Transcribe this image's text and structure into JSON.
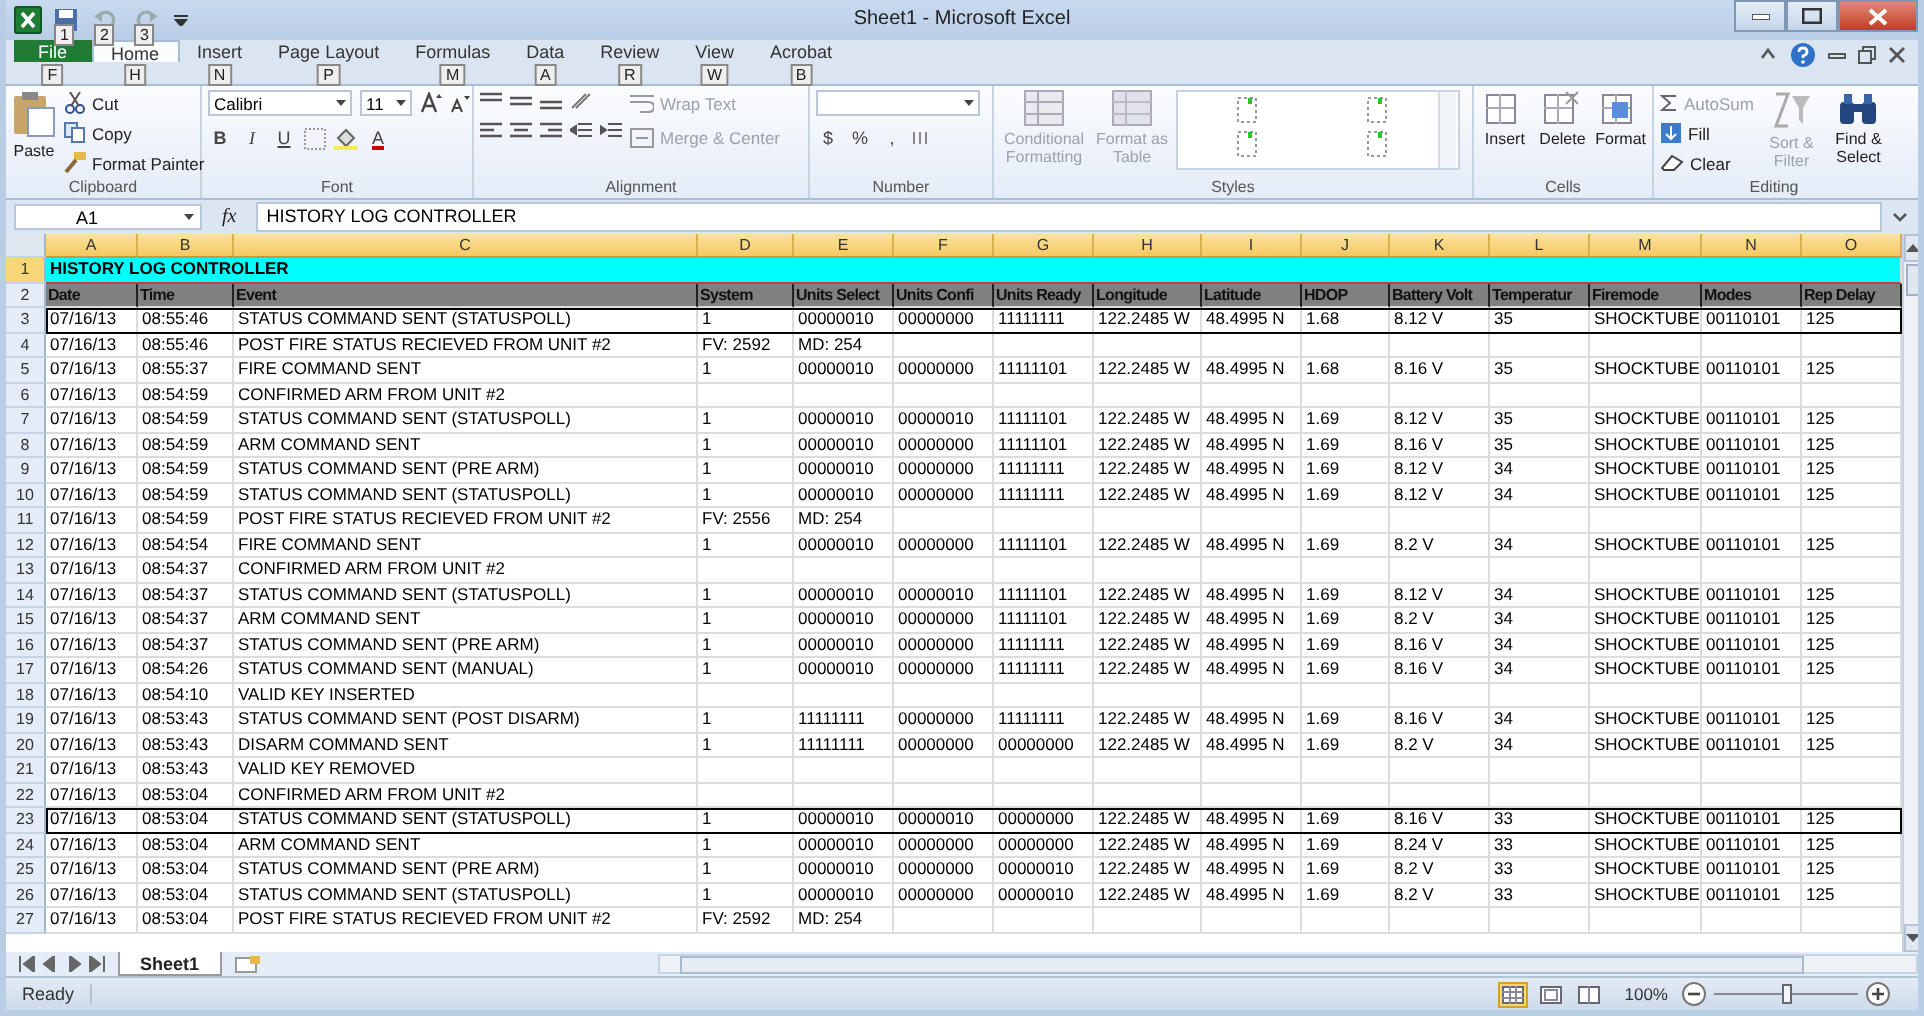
{
  "window": {
    "title": "Sheet1  -  Microsoft Excel"
  },
  "quick_access": [
    {
      "keytip": "1"
    },
    {
      "keytip": "2"
    },
    {
      "keytip": "3"
    }
  ],
  "tabs": [
    {
      "label": "File",
      "keytip": "F",
      "selected": false,
      "kind": "file"
    },
    {
      "label": "Home",
      "keytip": "H",
      "selected": true,
      "kind": "tab"
    },
    {
      "label": "Insert",
      "keytip": "N",
      "selected": false,
      "kind": "tab"
    },
    {
      "label": "Page Layout",
      "keytip": "P",
      "selected": false,
      "kind": "tab"
    },
    {
      "label": "Formulas",
      "keytip": "M",
      "selected": false,
      "kind": "tab"
    },
    {
      "label": "Data",
      "keytip": "A",
      "selected": false,
      "kind": "tab"
    },
    {
      "label": "Review",
      "keytip": "R",
      "selected": false,
      "kind": "tab"
    },
    {
      "label": "View",
      "keytip": "W",
      "selected": false,
      "kind": "tab"
    },
    {
      "label": "Acrobat",
      "keytip": "B",
      "selected": false,
      "kind": "tab"
    }
  ],
  "ribbon": {
    "clipboard": {
      "label": "Clipboard",
      "paste": "Paste",
      "cut": "Cut",
      "copy": "Copy",
      "format_painter": "Format Painter"
    },
    "font": {
      "label": "Font",
      "name": "Calibri",
      "size": "11",
      "bold": "B",
      "italic": "I",
      "underline": "U",
      "text_color": "A"
    },
    "alignment": {
      "label": "Alignment",
      "wrap": {
        "label": "Wrap Text",
        "disabled": true
      },
      "merge": {
        "label": "Merge & Center",
        "disabled": true
      }
    },
    "number": {
      "label": "Number",
      "currency": "$",
      "percent": "%",
      "comma": ","
    },
    "styles": {
      "label": "Styles",
      "conditional": {
        "label": "Conditional Formatting",
        "disabled": true
      },
      "table": {
        "label": "Format as Table",
        "disabled": true
      }
    },
    "cells": {
      "label": "Cells",
      "buttons": [
        {
          "label": "Insert",
          "disabled": false
        },
        {
          "label": "Delete",
          "disabled": false
        },
        {
          "label": "Format",
          "disabled": false
        }
      ]
    },
    "editing": {
      "label": "Editing",
      "autosum": {
        "label": "AutoSum",
        "disabled": true
      },
      "fill": {
        "label": "Fill",
        "disabled": false
      },
      "clear": {
        "label": "Clear",
        "disabled": false
      },
      "sort": {
        "label": "Sort & Filter",
        "disabled": true
      },
      "find": {
        "label": "Find & Select",
        "disabled": false
      }
    }
  },
  "formula_bar": {
    "name_box": "A1",
    "fx": "fx",
    "value": "HISTORY LOG CONTROLLER"
  },
  "columns": [
    "A",
    "B",
    "C",
    "D",
    "E",
    "F",
    "G",
    "H",
    "I",
    "J",
    "K",
    "L",
    "M",
    "N",
    "O"
  ],
  "title_row": {
    "n": "1",
    "text": "HISTORY LOG CONTROLLER"
  },
  "header_row": {
    "n": "2",
    "cells": [
      "Date",
      "Time",
      "Event",
      "System",
      "Units Select",
      "Units Confi",
      "Units Ready",
      "Longitude",
      "Latitude",
      "HDOP",
      "Battery Volt",
      "Temperatur",
      "Firemode",
      "Modes",
      "Rep Delay"
    ]
  },
  "rows": [
    {
      "n": "3",
      "boxed": true,
      "cells": [
        "07/16/13",
        "08:55:46",
        "STATUS COMMAND SENT (STATUSPOLL)",
        "1",
        "00000010",
        "00000000",
        "11111111",
        "122.2485 W",
        "48.4995 N",
        "1.68",
        "8.12 V",
        "35",
        "SHOCKTUBE",
        "00110101",
        "125"
      ]
    },
    {
      "n": "4",
      "boxed": false,
      "cells": [
        "07/16/13",
        "08:55:46",
        "POST FIRE STATUS RECIEVED FROM UNIT #2",
        "FV: 2592",
        "MD: 254"
      ]
    },
    {
      "n": "5",
      "boxed": false,
      "cells": [
        "07/16/13",
        "08:55:37",
        "FIRE COMMAND SENT",
        "1",
        "00000010",
        "00000000",
        "11111101",
        "122.2485 W",
        "48.4995 N",
        "1.68",
        "8.16 V",
        "35",
        "SHOCKTUBE",
        "00110101",
        "125"
      ]
    },
    {
      "n": "6",
      "boxed": false,
      "cells": [
        "07/16/13",
        "08:54:59",
        "CONFIRMED ARM FROM UNIT #2"
      ]
    },
    {
      "n": "7",
      "boxed": false,
      "cells": [
        "07/16/13",
        "08:54:59",
        "STATUS COMMAND SENT (STATUSPOLL)",
        "1",
        "00000010",
        "00000010",
        "11111101",
        "122.2485 W",
        "48.4995 N",
        "1.69",
        "8.12 V",
        "35",
        "SHOCKTUBE",
        "00110101",
        "125"
      ]
    },
    {
      "n": "8",
      "boxed": false,
      "cells": [
        "07/16/13",
        "08:54:59",
        "ARM COMMAND SENT",
        "1",
        "00000010",
        "00000000",
        "11111101",
        "122.2485 W",
        "48.4995 N",
        "1.69",
        "8.16 V",
        "35",
        "SHOCKTUBE",
        "00110101",
        "125"
      ]
    },
    {
      "n": "9",
      "boxed": false,
      "cells": [
        "07/16/13",
        "08:54:59",
        "STATUS COMMAND SENT (PRE ARM)",
        "1",
        "00000010",
        "00000000",
        "11111111",
        "122.2485 W",
        "48.4995 N",
        "1.69",
        "8.12 V",
        "34",
        "SHOCKTUBE",
        "00110101",
        "125"
      ]
    },
    {
      "n": "10",
      "boxed": false,
      "cells": [
        "07/16/13",
        "08:54:59",
        "STATUS COMMAND SENT (STATUSPOLL)",
        "1",
        "00000010",
        "00000000",
        "11111111",
        "122.2485 W",
        "48.4995 N",
        "1.69",
        "8.12 V",
        "34",
        "SHOCKTUBE",
        "00110101",
        "125"
      ]
    },
    {
      "n": "11",
      "boxed": false,
      "cells": [
        "07/16/13",
        "08:54:59",
        "POST FIRE STATUS RECIEVED FROM UNIT #2",
        "FV: 2556",
        "MD: 254"
      ]
    },
    {
      "n": "12",
      "boxed": false,
      "cells": [
        "07/16/13",
        "08:54:54",
        "FIRE COMMAND SENT",
        "1",
        "00000010",
        "00000000",
        "11111101",
        "122.2485 W",
        "48.4995 N",
        "1.69",
        "8.2 V",
        "34",
        "SHOCKTUBE",
        "00110101",
        "125"
      ]
    },
    {
      "n": "13",
      "boxed": false,
      "cells": [
        "07/16/13",
        "08:54:37",
        "CONFIRMED ARM FROM UNIT #2"
      ]
    },
    {
      "n": "14",
      "boxed": false,
      "cells": [
        "07/16/13",
        "08:54:37",
        "STATUS COMMAND SENT (STATUSPOLL)",
        "1",
        "00000010",
        "00000010",
        "11111101",
        "122.2485 W",
        "48.4995 N",
        "1.69",
        "8.12 V",
        "34",
        "SHOCKTUBE",
        "00110101",
        "125"
      ]
    },
    {
      "n": "15",
      "boxed": false,
      "cells": [
        "07/16/13",
        "08:54:37",
        "ARM COMMAND SENT",
        "1",
        "00000010",
        "00000000",
        "11111101",
        "122.2485 W",
        "48.4995 N",
        "1.69",
        "8.2 V",
        "34",
        "SHOCKTUBE",
        "00110101",
        "125"
      ]
    },
    {
      "n": "16",
      "boxed": false,
      "cells": [
        "07/16/13",
        "08:54:37",
        "STATUS COMMAND SENT (PRE ARM)",
        "1",
        "00000010",
        "00000000",
        "11111111",
        "122.2485 W",
        "48.4995 N",
        "1.69",
        "8.16 V",
        "34",
        "SHOCKTUBE",
        "00110101",
        "125"
      ]
    },
    {
      "n": "17",
      "boxed": false,
      "cells": [
        "07/16/13",
        "08:54:26",
        "STATUS COMMAND SENT (MANUAL)",
        "1",
        "00000010",
        "00000000",
        "11111111",
        "122.2485 W",
        "48.4995 N",
        "1.69",
        "8.16 V",
        "34",
        "SHOCKTUBE",
        "00110101",
        "125"
      ]
    },
    {
      "n": "18",
      "boxed": false,
      "cells": [
        "07/16/13",
        "08:54:10",
        "VALID KEY INSERTED"
      ]
    },
    {
      "n": "19",
      "boxed": false,
      "cells": [
        "07/16/13",
        "08:53:43",
        "STATUS COMMAND SENT (POST DISARM)",
        "1",
        "11111111",
        "00000000",
        "11111111",
        "122.2485 W",
        "48.4995 N",
        "1.69",
        "8.16 V",
        "34",
        "SHOCKTUBE",
        "00110101",
        "125"
      ]
    },
    {
      "n": "20",
      "boxed": false,
      "cells": [
        "07/16/13",
        "08:53:43",
        "DISARM COMMAND SENT",
        "1",
        "11111111",
        "00000000",
        "00000000",
        "122.2485 W",
        "48.4995 N",
        "1.69",
        "8.2 V",
        "34",
        "SHOCKTUBE",
        "00110101",
        "125"
      ]
    },
    {
      "n": "21",
      "boxed": false,
      "cells": [
        "07/16/13",
        "08:53:43",
        "VALID KEY REMOVED"
      ]
    },
    {
      "n": "22",
      "boxed": false,
      "cells": [
        "07/16/13",
        "08:53:04",
        "CONFIRMED ARM FROM UNIT #2"
      ]
    },
    {
      "n": "23",
      "boxed": true,
      "cells": [
        "07/16/13",
        "08:53:04",
        "STATUS COMMAND SENT (STATUSPOLL)",
        "1",
        "00000010",
        "00000010",
        "00000000",
        "122.2485 W",
        "48.4995 N",
        "1.69",
        "8.16 V",
        "33",
        "SHOCKTUBE",
        "00110101",
        "125"
      ]
    },
    {
      "n": "24",
      "boxed": false,
      "cells": [
        "07/16/13",
        "08:53:04",
        "ARM COMMAND SENT",
        "1",
        "00000010",
        "00000000",
        "00000000",
        "122.2485 W",
        "48.4995 N",
        "1.69",
        "8.24 V",
        "33",
        "SHOCKTUBE",
        "00110101",
        "125"
      ]
    },
    {
      "n": "25",
      "boxed": false,
      "cells": [
        "07/16/13",
        "08:53:04",
        "STATUS COMMAND SENT (PRE ARM)",
        "1",
        "00000010",
        "00000000",
        "00000010",
        "122.2485 W",
        "48.4995 N",
        "1.69",
        "8.2 V",
        "33",
        "SHOCKTUBE",
        "00110101",
        "125"
      ]
    },
    {
      "n": "26",
      "boxed": false,
      "cells": [
        "07/16/13",
        "08:53:04",
        "STATUS COMMAND SENT (STATUSPOLL)",
        "1",
        "00000010",
        "00000000",
        "00000010",
        "122.2485 W",
        "48.4995 N",
        "1.69",
        "8.2 V",
        "33",
        "SHOCKTUBE",
        "00110101",
        "125"
      ]
    },
    {
      "n": "27",
      "boxed": false,
      "cells": [
        "07/16/13",
        "08:53:04",
        "POST FIRE STATUS RECIEVED FROM UNIT #2",
        "FV: 2592",
        "MD: 254"
      ]
    }
  ],
  "sheet_tabs": [
    {
      "label": "Sheet1",
      "selected": true
    }
  ],
  "status_bar": {
    "text": "Ready",
    "views": [
      {
        "kind": "normal",
        "selected": true
      },
      {
        "kind": "layout",
        "selected": false
      },
      {
        "kind": "break",
        "selected": false
      }
    ],
    "zoom": "100%",
    "zoom_slider": {
      "level": 0.5
    }
  }
}
